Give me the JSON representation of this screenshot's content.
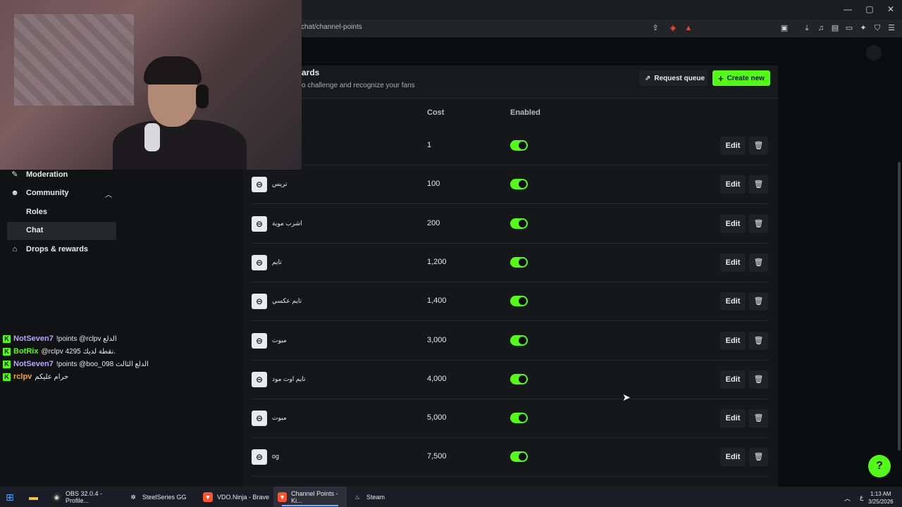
{
  "browser": {
    "url": "chat/channel-points",
    "window_controls": {
      "minimize": "—",
      "maximize": "▢",
      "close": "✕"
    }
  },
  "header": {
    "title": "ards",
    "subtitle": "o challenge and recognize your fans",
    "request_queue_label": "Request queue",
    "create_new_label": "Create new"
  },
  "table": {
    "columns": [
      "Cost",
      "Enabled"
    ],
    "rows": [
      {
        "name": "",
        "cost": "1",
        "enabled": true,
        "edit": "Edit"
      },
      {
        "name": "تريس",
        "cost": "100",
        "enabled": true,
        "edit": "Edit"
      },
      {
        "name": "اشرب موية",
        "cost": "200",
        "enabled": true,
        "edit": "Edit"
      },
      {
        "name": "تايم",
        "cost": "1,200",
        "enabled": true,
        "edit": "Edit"
      },
      {
        "name": "تايم عكسي",
        "cost": "1,400",
        "enabled": true,
        "edit": "Edit"
      },
      {
        "name": "ميوت",
        "cost": "3,000",
        "enabled": true,
        "edit": "Edit"
      },
      {
        "name": "تايم اوت مود",
        "cost": "4,000",
        "enabled": true,
        "edit": "Edit"
      },
      {
        "name": "ميوت",
        "cost": "5,000",
        "enabled": true,
        "edit": "Edit"
      },
      {
        "name": "og",
        "cost": "7,500",
        "enabled": true,
        "edit": "Edit"
      }
    ]
  },
  "sidebar": {
    "moderation": "Moderation",
    "community": "Community",
    "roles": "Roles",
    "chat": "Chat",
    "drops": "Drops & rewards"
  },
  "chat": [
    {
      "user": "NotSeven7",
      "color": "#b9a3ff",
      "message": "!points @rclpv الدلع"
    },
    {
      "user": "BotRix",
      "color": "#53fc18",
      "message": "@rclpv 4295 نقطة لديك."
    },
    {
      "user": "NotSeven7",
      "color": "#b9a3ff",
      "message": "!points @boo_098 الدلع الثالث"
    },
    {
      "user": "rclpv",
      "color": "#f0a53a",
      "message": "حرام عليكم"
    }
  ],
  "taskbar": {
    "items": [
      {
        "label": "OBS 32.0.4 - Profile...",
        "icon": "obs-icon"
      },
      {
        "label": "SteelSeries GG",
        "icon": "steelseries-icon"
      },
      {
        "label": "VDO.Ninja - Brave",
        "icon": "brave-icon"
      },
      {
        "label": "Channel Points - Ki...",
        "icon": "brave-icon"
      },
      {
        "label": "Steam",
        "icon": "steam-icon"
      }
    ],
    "time": "1:13 AM",
    "date": "3/25/2026",
    "lang": "ع"
  },
  "colors": {
    "accent": "#53fc18",
    "background": "#0b0c0d",
    "panel": "#151718"
  }
}
